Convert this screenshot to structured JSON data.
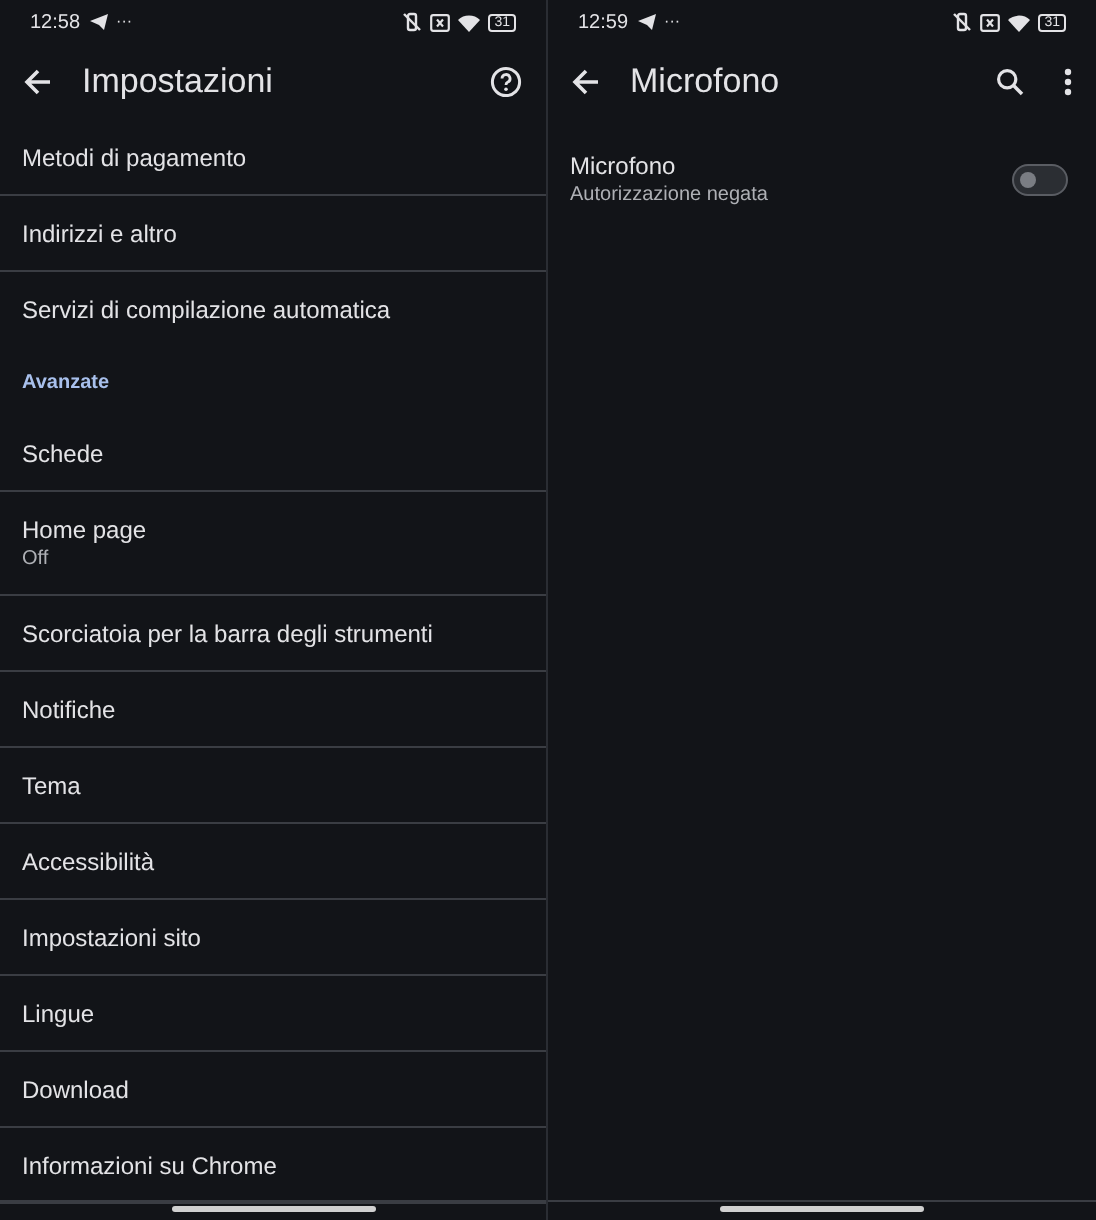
{
  "screens": [
    {
      "status_bar": {
        "time": "12:58",
        "more": "···",
        "battery": "31"
      },
      "app_bar": {
        "title": "Impostazioni",
        "actions": [
          {
            "kind": "help"
          }
        ]
      },
      "rows": [
        {
          "kind": "item",
          "title": "Metodi di pagamento"
        },
        {
          "kind": "item",
          "title": "Indirizzi e altro"
        },
        {
          "kind": "item",
          "title": "Servizi di compilazione automatica"
        },
        {
          "kind": "header",
          "title": "Avanzate"
        },
        {
          "kind": "item",
          "title": "Schede"
        },
        {
          "kind": "item",
          "title": "Home page",
          "subtitle": "Off"
        },
        {
          "kind": "item",
          "title": "Scorciatoia per la barra degli strumenti"
        },
        {
          "kind": "item",
          "title": "Notifiche"
        },
        {
          "kind": "item",
          "title": "Tema"
        },
        {
          "kind": "item",
          "title": "Accessibilità"
        },
        {
          "kind": "item",
          "title": "Impostazioni sito"
        },
        {
          "kind": "item",
          "title": "Lingue"
        },
        {
          "kind": "item",
          "title": "Download"
        },
        {
          "kind": "item",
          "title": "Informazioni su Chrome"
        }
      ]
    },
    {
      "status_bar": {
        "time": "12:59",
        "more": "···",
        "battery": "31"
      },
      "app_bar": {
        "title": "Microfono",
        "actions": [
          {
            "kind": "search"
          },
          {
            "kind": "more"
          }
        ]
      },
      "rows": [
        {
          "kind": "toggle",
          "title": "Microfono",
          "subtitle": "Autorizzazione negata",
          "checked": false
        }
      ]
    }
  ]
}
